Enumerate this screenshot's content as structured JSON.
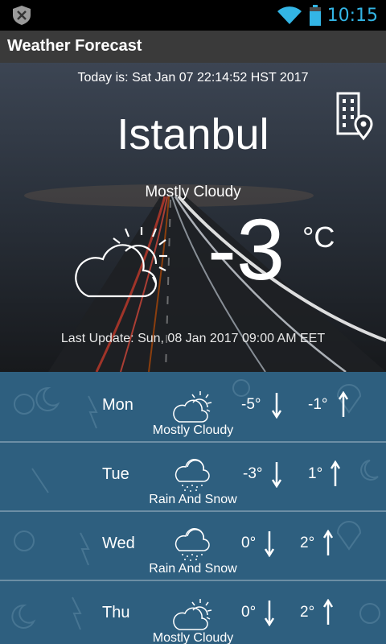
{
  "status": {
    "time": "10:15",
    "icons": [
      "shield-icon",
      "wifi-icon",
      "battery-icon"
    ]
  },
  "app": {
    "title": "Weather Forecast"
  },
  "current": {
    "today": "Today is: Sat Jan 07 22:14:52 HST 2017",
    "city": "Istanbul",
    "condition": "Mostly Cloudy",
    "temp": "-3",
    "unit": "°C",
    "last_update": "Last Update: Sun, 08 Jan 2017 09:00 AM EET",
    "icon": "cloud-sun-icon"
  },
  "forecast": [
    {
      "day": "Mon",
      "low": "-5°",
      "high": "-1°",
      "condition": "Mostly Cloudy",
      "icon": "cloud-sun-icon"
    },
    {
      "day": "Tue",
      "low": "-3°",
      "high": "1°",
      "condition": "Rain And Snow",
      "icon": "rain-snow-icon"
    },
    {
      "day": "Wed",
      "low": "0°",
      "high": "2°",
      "condition": "Rain And Snow",
      "icon": "rain-snow-icon"
    },
    {
      "day": "Thu",
      "low": "0°",
      "high": "2°",
      "condition": "Mostly Cloudy",
      "icon": "cloud-sun-icon"
    }
  ],
  "colors": {
    "forecast_bg": "#2e5f7f",
    "title_bar": "#3a3a3a",
    "clock": "#33b5e5"
  }
}
